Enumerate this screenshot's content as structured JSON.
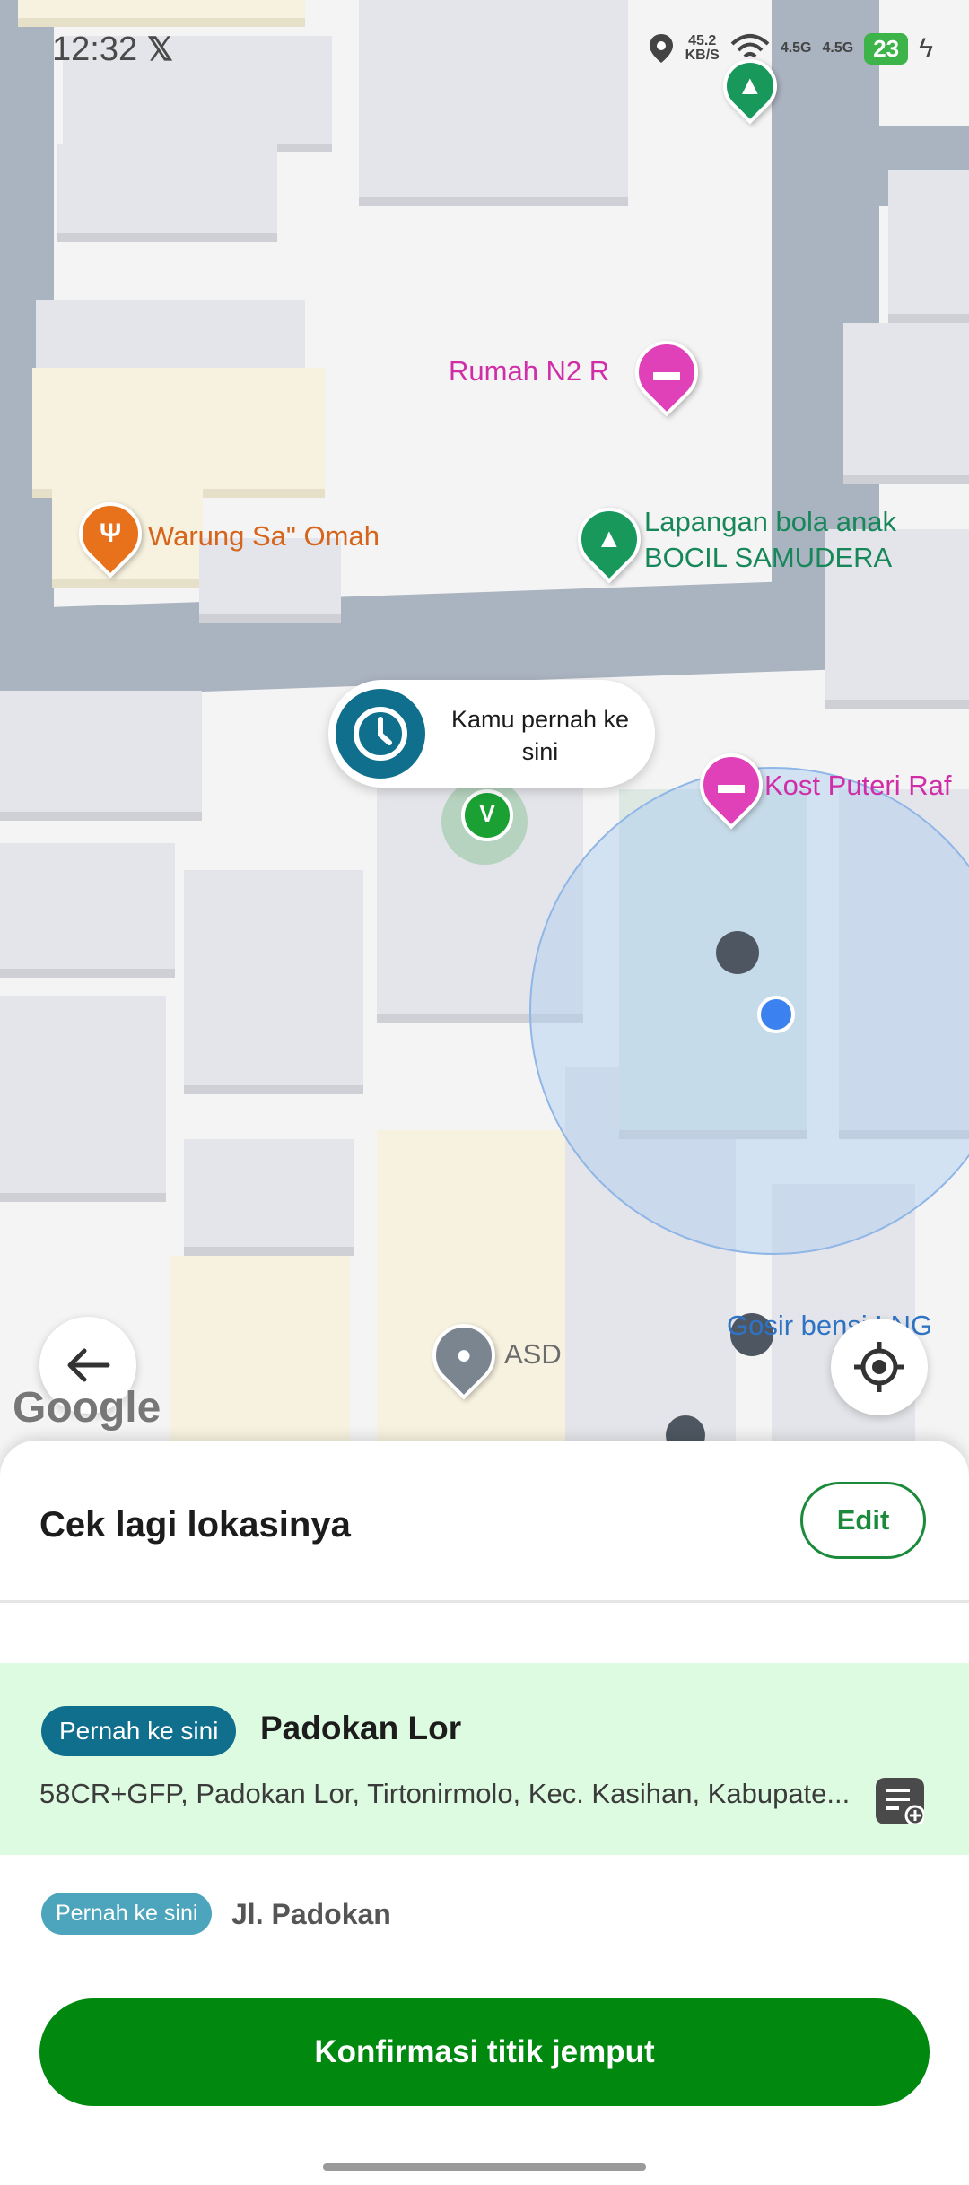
{
  "status_bar": {
    "time": "12:32",
    "x_logo": "𝕏",
    "speed_top": "45.2",
    "speed_unit": "KB/S",
    "net1": "4.5G",
    "net2": "4.5G",
    "battery": "23"
  },
  "map": {
    "pois": [
      {
        "label": "Rumah N2 R",
        "icon": "bed-icon",
        "color": "#e040b8"
      },
      {
        "label": "Warung Sa\" Omah",
        "icon": "fork-knife-icon",
        "color": "#e8711c"
      },
      {
        "label_line1": "Lapangan bola anak",
        "label_line2": "BOCIL SAMUDERA",
        "icon": "tree-icon",
        "color": "#19985c"
      },
      {
        "label": "Kost Puteri Raf",
        "icon": "bed-icon",
        "color": "#e040b8"
      },
      {
        "label": "ASD",
        "icon": "location-pin-icon",
        "color": "#7a8590"
      },
      {
        "label": "Gosir bensi LNG",
        "icon": "",
        "color": "#2e73c4"
      }
    ],
    "bubble_text": "Kamu pernah ke sini",
    "google_logo": "Google"
  },
  "sheet": {
    "title": "Cek lagi lokasinya",
    "edit_label": "Edit",
    "selected": {
      "badge": "Pernah ke sini",
      "name": "Padokan Lor",
      "address": "58CR+GFP, Padokan Lor, Tirtonirmolo, Kec. Kasihan, Kabupate..."
    },
    "other": {
      "badge": "Pernah ke sini",
      "name": "Jl. Padokan"
    },
    "confirm_label": "Konfirmasi titik jemput"
  },
  "colors": {
    "primary_green": "#00880f",
    "teal": "#0f6f8c",
    "selected_bg": "#ddfbe0"
  }
}
